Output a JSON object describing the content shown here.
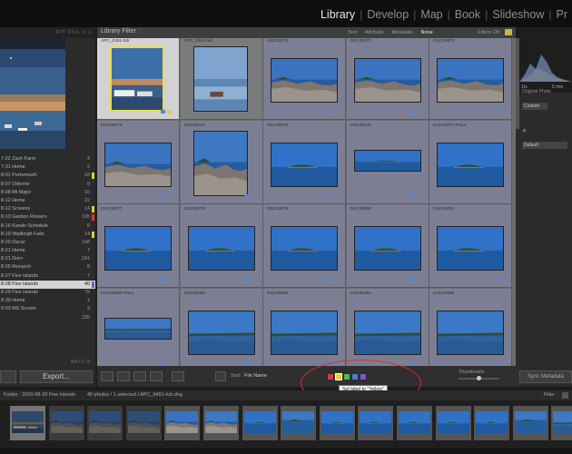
{
  "modules": {
    "items": [
      "Library",
      "Develop",
      "Map",
      "Book",
      "Slideshow",
      "Pr"
    ],
    "active": "Library"
  },
  "navigator": {
    "header": "FIT  FILL  1:1"
  },
  "collections": {
    "rows": [
      {
        "name": "7-22 Zach Farm",
        "count": "4",
        "flag": ""
      },
      {
        "name": "7-31 Home",
        "count": "2",
        "flag": ""
      },
      {
        "name": "8-01 Portsmouth",
        "count": "18",
        "flag": "#d7cf3d"
      },
      {
        "name": "8-07 Odiorne",
        "count": "8",
        "flag": ""
      },
      {
        "name": "8-08 Mt Major",
        "count": "15",
        "flag": ""
      },
      {
        "name": "8-12 Home",
        "count": "22",
        "flag": ""
      },
      {
        "name": "8-12 Screens",
        "count": "14",
        "flag": "#d7cf3d"
      },
      {
        "name": "8-13 Garden Flowers",
        "count": "105",
        "flag": "#d43c3c"
      },
      {
        "name": "8-16 Kando Schedule",
        "count": "6",
        "flag": ""
      },
      {
        "name": "8-19 Wadleigh Falls",
        "count": "14",
        "flag": "#d7cf3d"
      },
      {
        "name": "8-20 Oscar",
        "count": "148",
        "flag": ""
      },
      {
        "name": "8-21 Home",
        "count": "7",
        "flag": ""
      },
      {
        "name": "8-21 Dorn",
        "count": "241",
        "flag": ""
      },
      {
        "name": "8-25 Monarch",
        "count": "8",
        "flag": ""
      },
      {
        "name": "8-27 Five Islands",
        "count": "7",
        "flag": ""
      },
      {
        "name": "8-28 Five Islands",
        "count": "40",
        "flag": "#7a5cd0",
        "selected": true
      },
      {
        "name": "8-29 Five Islands",
        "count": "79",
        "flag": ""
      },
      {
        "name": "8-30 Home",
        "count": "1",
        "flag": ""
      },
      {
        "name": "9-03 MS Screen",
        "count": "3",
        "flag": ""
      },
      {
        "name": "",
        "count": "235",
        "flag": ""
      }
    ],
    "footer": "8/4 / 2 / 8",
    "import_label": "",
    "export_label": "Export..."
  },
  "filter_bar": {
    "title": "Library Filter :",
    "tabs": [
      "Text",
      "Attribute",
      "Metadata",
      "None"
    ],
    "active_tab": "None",
    "filters_off": "Filters Off"
  },
  "grid": {
    "cells": [
      {
        "name": "APC_0491-hdr",
        "scene": "winter",
        "state": "sel",
        "portrait": true,
        "yellow": true
      },
      {
        "name": "APC_0493.hdr",
        "scene": "winterdusk",
        "state": "norm",
        "portrait": true
      },
      {
        "name": "DSC00071",
        "scene": "rocks",
        "state": "hi"
      },
      {
        "name": "DSC00072",
        "scene": "rocks",
        "state": "hi"
      },
      {
        "name": "DSC00073",
        "scene": "rocks",
        "state": "hi"
      },
      {
        "name": "DSC00074",
        "scene": "rocks",
        "state": "hi"
      },
      {
        "name": "DSC00074",
        "scene": "rocksport",
        "state": "hi",
        "portrait": true
      },
      {
        "name": "DSC00075",
        "scene": "island",
        "state": "hi"
      },
      {
        "name": "DSC00076",
        "scene": "island",
        "state": "hi",
        "pano": true
      },
      {
        "name": "DSC00077-Pano",
        "scene": "island",
        "state": "hi"
      },
      {
        "name": "DSC00077",
        "scene": "island",
        "state": "hi"
      },
      {
        "name": "DSC00078",
        "scene": "island",
        "state": "hi"
      },
      {
        "name": "DSC00079",
        "scene": "island",
        "state": "hi"
      },
      {
        "name": "DSC00080",
        "scene": "island",
        "state": "hi"
      },
      {
        "name": "DSC00081",
        "scene": "island",
        "state": "hi"
      },
      {
        "name": "DSC00082-Pano",
        "scene": "bay",
        "state": "hi",
        "pano": true
      },
      {
        "name": "DSC00082",
        "scene": "bay",
        "state": "hi"
      },
      {
        "name": "DSC00083",
        "scene": "bay",
        "state": "hi"
      },
      {
        "name": "DSC00084",
        "scene": "bay",
        "state": "hi"
      },
      {
        "name": "DSC00085",
        "scene": "bay",
        "state": "hi"
      }
    ]
  },
  "right_panel": {
    "exposure": "1/s",
    "shutter": "5 min",
    "original_photo": "Original Photo",
    "custom": "Custom",
    "default": "Default",
    "sync_metadata": "Sync Metadata"
  },
  "toolbar": {
    "sort_label": "Sort:",
    "sort_value": "File Name",
    "labels": [
      "#d23b3b",
      "#e3d23a",
      "#56b84c",
      "#4a7fd0",
      "#8552c9"
    ],
    "thumbnails_label": "Thumbnails",
    "tooltip": "Set label to \"Yellow\""
  },
  "filmstrip": {
    "path": "Folder : 2020-08-28 Five Islands",
    "count": "40 photos / 1 selected / APC_0491-hdr.dng",
    "filter_label": "Filter :",
    "scenes": [
      "winter",
      "rocks",
      "rocks",
      "rocks",
      "rocks",
      "rocksport",
      "island",
      "pano",
      "island",
      "island",
      "island",
      "island",
      "island",
      "pano",
      "bay"
    ]
  },
  "colors": {
    "selection_yellow": "#e8dd4a",
    "annotation_red": "#e02a2a"
  }
}
